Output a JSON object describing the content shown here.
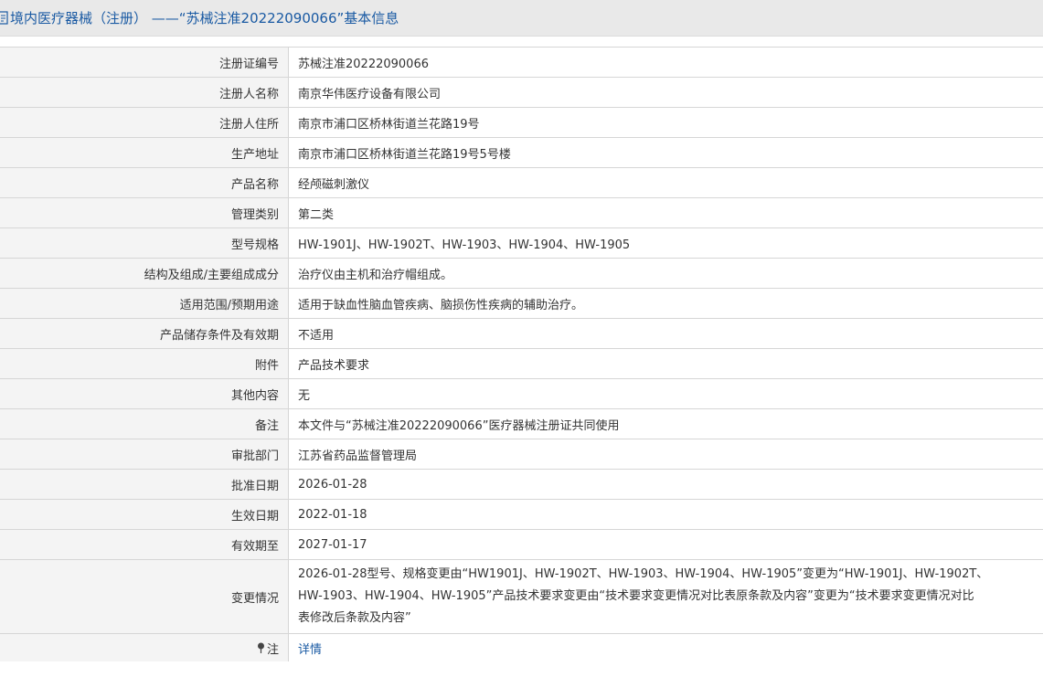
{
  "header": {
    "title": "境内医疗器械（注册） ——“苏械注准20222090066”基本信息"
  },
  "rows": [
    {
      "label": "注册证编号",
      "value": "苏械注准20222090066"
    },
    {
      "label": "注册人名称",
      "value": "南京华伟医疗设备有限公司"
    },
    {
      "label": "注册人住所",
      "value": "南京市浦口区桥林街道兰花路19号"
    },
    {
      "label": "生产地址",
      "value": "南京市浦口区桥林街道兰花路19号5号楼"
    },
    {
      "label": "产品名称",
      "value": "经颅磁刺激仪"
    },
    {
      "label": "管理类别",
      "value": "第二类"
    },
    {
      "label": "型号规格",
      "value": "HW-1901J、HW-1902T、HW-1903、HW-1904、HW-1905"
    },
    {
      "label": "结构及组成/主要组成成分",
      "value": "治疗仪由主机和治疗帽组成。"
    },
    {
      "label": "适用范围/预期用途",
      "value": "适用于缺血性脑血管疾病、脑损伤性疾病的辅助治疗。"
    },
    {
      "label": "产品储存条件及有效期",
      "value": "不适用"
    },
    {
      "label": "附件",
      "value": "产品技术要求"
    },
    {
      "label": "其他内容",
      "value": "无"
    },
    {
      "label": "备注",
      "value": "本文件与“苏械注准20222090066”医疗器械注册证共同使用"
    },
    {
      "label": "审批部门",
      "value": "江苏省药品监督管理局"
    },
    {
      "label": "批准日期",
      "value": "2026-01-28"
    },
    {
      "label": "生效日期",
      "value": "2022-01-18"
    },
    {
      "label": "有效期至",
      "value": "2027-01-17"
    },
    {
      "label": "变更情况",
      "lines": [
        "2026-01-28型号、规格变更由“HW1901J、HW-1902T、HW-1903、HW-1904、HW-1905”变更为“HW-1901J、HW-1902T、",
        "HW-1903、HW-1904、HW-1905”产品技术要求变更由“技术要求变更情况对比表原条款及内容”变更为“技术要求变更情况对比",
        "表修改后条款及内容”"
      ]
    },
    {
      "label": "注",
      "value": "详情"
    }
  ],
  "icons": {
    "header": "page-icon",
    "note": "pin-icon"
  },
  "colors": {
    "link": "#1a5aa3",
    "label_bg": "#f4f4f4",
    "header_bg": "#e9e9e9",
    "border": "#d6d6d6"
  }
}
